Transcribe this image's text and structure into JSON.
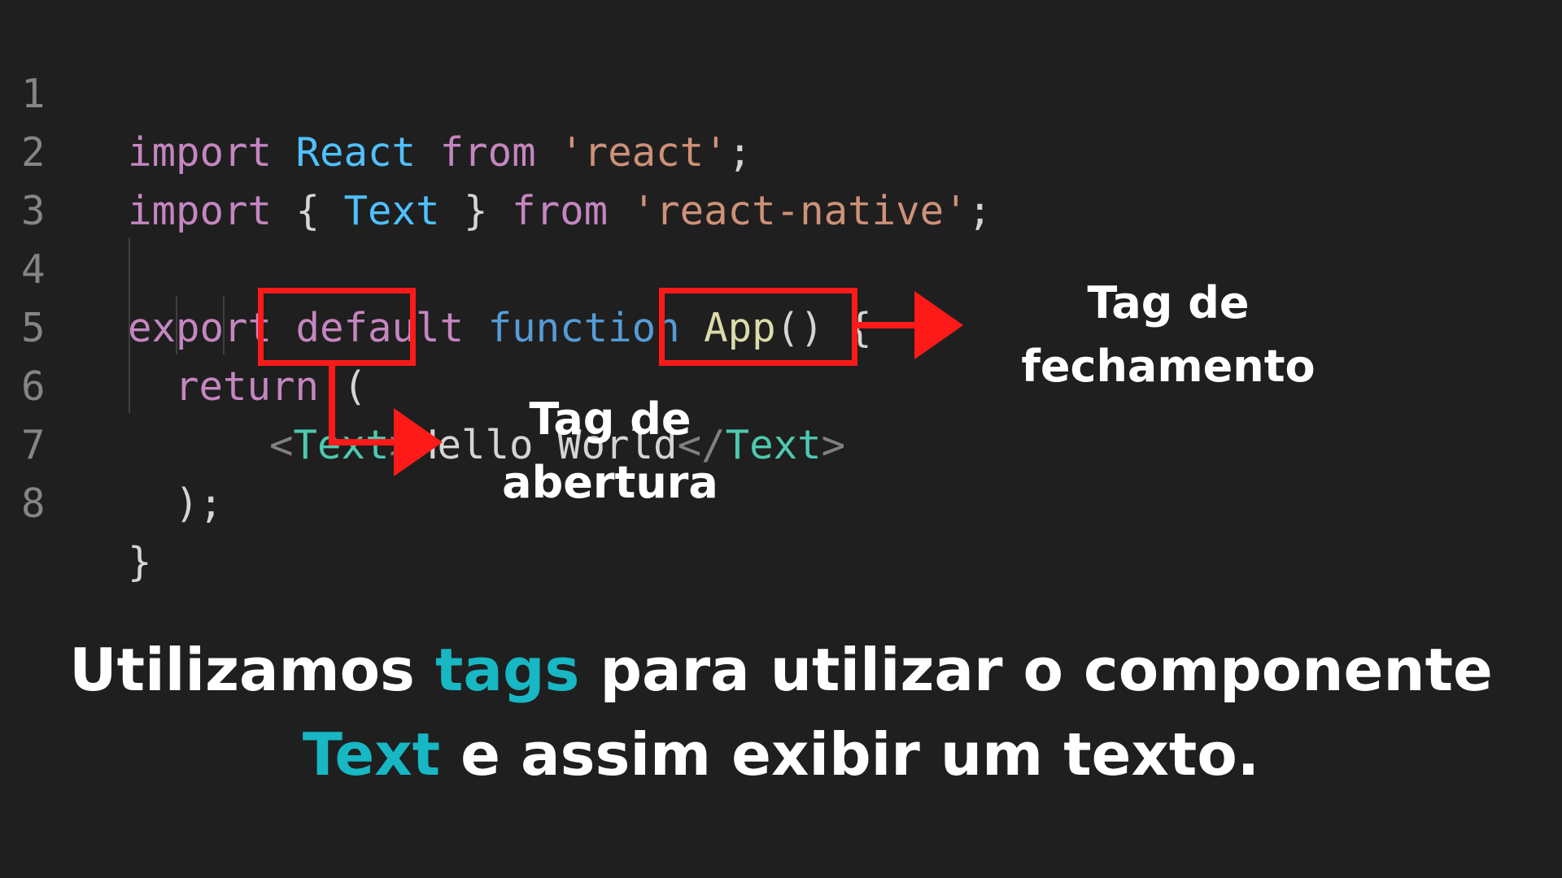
{
  "code": {
    "lines": [
      {
        "num": "1",
        "tokens": [
          "import",
          " ",
          "React",
          " ",
          "from",
          " ",
          "'react'",
          ";"
        ]
      },
      {
        "num": "2",
        "tokens": [
          "import",
          " { ",
          "Text",
          " } ",
          "from",
          " ",
          "'react-native'",
          ";"
        ]
      },
      {
        "num": "3",
        "tokens": []
      },
      {
        "num": "4",
        "tokens": [
          "export",
          " ",
          "default",
          " ",
          "function",
          " ",
          "App",
          "() {"
        ]
      },
      {
        "num": "5",
        "tokens": [
          "return",
          " ("
        ]
      },
      {
        "num": "6",
        "tokens": [
          "<",
          "Text",
          ">",
          "Hello World",
          "</",
          "Text",
          ">"
        ]
      },
      {
        "num": "7",
        "tokens": [
          ");"
        ]
      },
      {
        "num": "8",
        "tokens": [
          "}"
        ]
      }
    ]
  },
  "annotations": {
    "opening": {
      "line1": "Tag de",
      "line2": "abertura"
    },
    "closing": {
      "line1": "Tag de",
      "line2": "fechamento"
    },
    "highlight_color": "#ff1a1a"
  },
  "caption": {
    "line1_a": "Utilizamos ",
    "line1_accent": "tags",
    "line1_b": " para utilizar o componente",
    "line2_accent": "Text",
    "line2_b": " e assim exibir um texto.",
    "accent_color": "#17b7c4"
  }
}
